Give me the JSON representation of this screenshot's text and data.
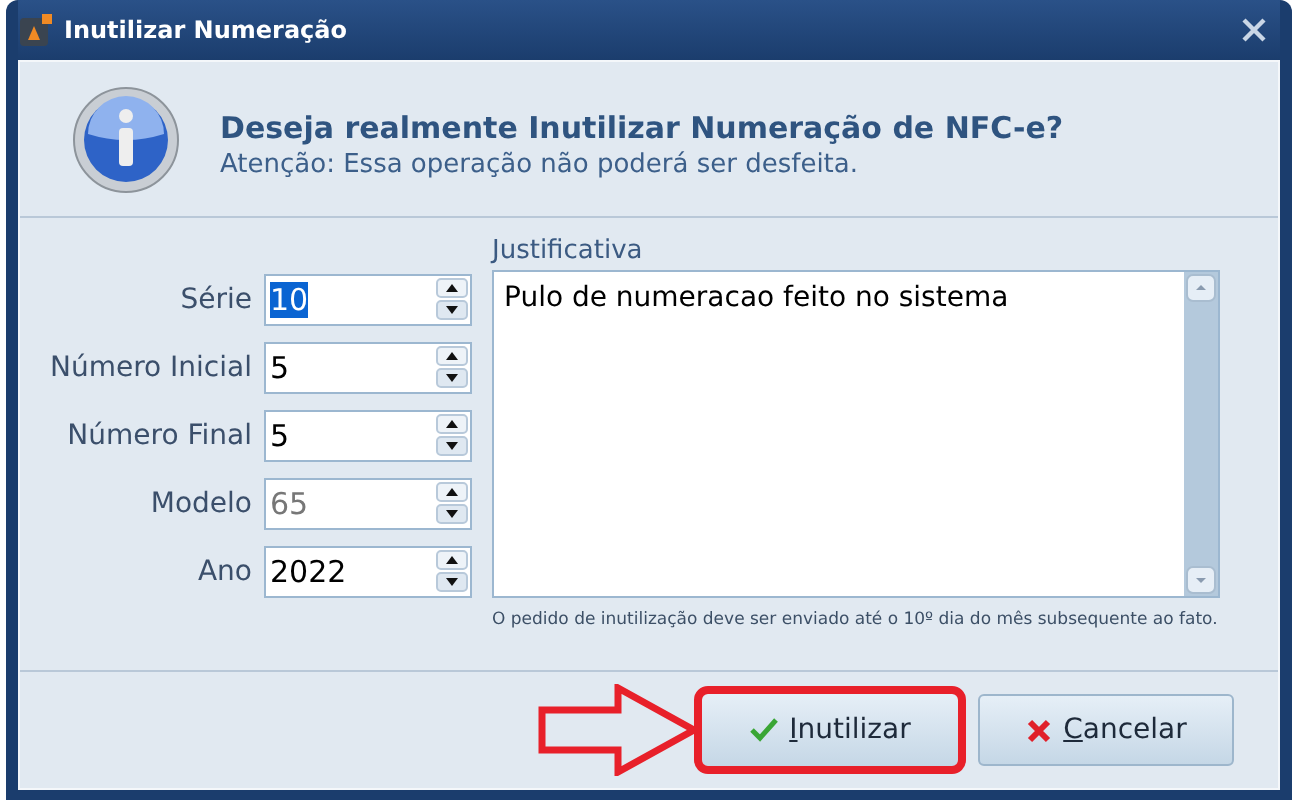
{
  "window": {
    "title": "Inutilizar Numeração"
  },
  "header": {
    "question": "Deseja realmente Inutilizar Numeração de NFC-e?",
    "warning": "Atenção: Essa operação não poderá ser desfeita."
  },
  "fields": [
    {
      "label": "Série",
      "value": "10",
      "highlighted": true,
      "disabled": false
    },
    {
      "label": "Número Inicial",
      "value": "5",
      "highlighted": false,
      "disabled": false
    },
    {
      "label": "Número Final",
      "value": "5",
      "highlighted": false,
      "disabled": false
    },
    {
      "label": "Modelo",
      "value": "65",
      "highlighted": false,
      "disabled": true
    },
    {
      "label": "Ano",
      "value": "2022",
      "highlighted": false,
      "disabled": false
    }
  ],
  "justificativa": {
    "label": "Justificativa",
    "value": "Pulo de numeracao feito no sistema",
    "note": "O pedido de inutilização deve ser enviado até o 10º dia do mês subsequente ao fato."
  },
  "buttons": [
    {
      "kind": "confirm",
      "label": "Inutilizar",
      "highlighted": true
    },
    {
      "kind": "cancel",
      "label": "Cancelar",
      "highlighted": false
    }
  ]
}
